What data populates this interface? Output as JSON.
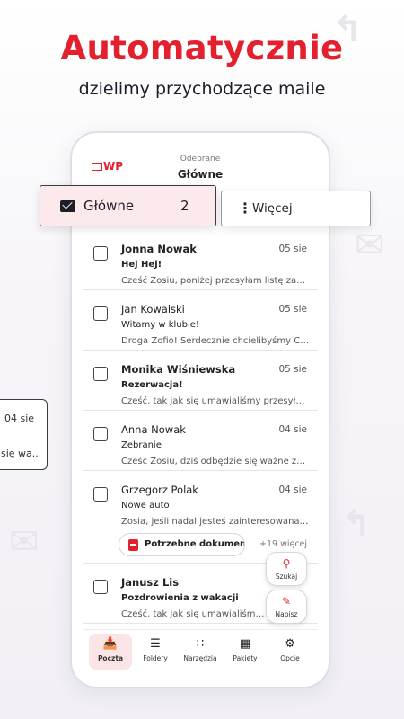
{
  "promo": {
    "headline": "Automatycznie",
    "subheadline": "dzielimy przychodzące maile"
  },
  "app": {
    "logo_text": "WP",
    "header_subtitle": "Odebrane",
    "header_title": "Główne"
  },
  "folder_tabs": {
    "main_label": "Główne",
    "main_count": "2",
    "more_label": "Więcej"
  },
  "mails": [
    {
      "from": "Jonna Nowak",
      "date": "05 sie",
      "subject": "Hej Hej!",
      "preview": "Cześć Zosiu, poniżej przesyłam listę zada...",
      "unread": true
    },
    {
      "from": "Jan Kowalski",
      "date": "05 sie",
      "subject": "Witamy w klubie!",
      "preview": "Droga Zofio! Serdecznie chcielibyśmy Cię...",
      "unread": false
    },
    {
      "from": "Monika Wiśniewska",
      "date": "05 sie",
      "subject": "Rezerwacja!",
      "preview": "Cześć, tak jak się umawialiśmy przesyłama",
      "unread": true
    },
    {
      "from": "Anna Nowak",
      "date": "04 sie",
      "subject": "Zebranie",
      "preview": "Cześć Zosiu, dziś odbędzie się ważne ze...",
      "unread": false
    },
    {
      "from": "Grzegorz Polak",
      "date": "04 sie",
      "subject": "Nowe auto",
      "preview": "Zosia, jeśli nadal jesteś zainteresowana k...",
      "unread": false,
      "attachment": "Potrzebne dokumen...",
      "more": "+19 więcej"
    },
    {
      "from": "Janusz Lis",
      "date": "",
      "subject": "Pozdrowienia z wakacji",
      "preview": "Cześć, tak jak się umawialiśmy przes...",
      "unread": true
    }
  ],
  "fabs": {
    "search_label": "Szukaj",
    "compose_label": "Napisz"
  },
  "bottom_nav": [
    {
      "label": "Poczta",
      "icon": "inbox-icon",
      "active": true
    },
    {
      "label": "Foldery",
      "icon": "menu-icon",
      "active": false
    },
    {
      "label": "Narzędzia",
      "icon": "grid-icon",
      "active": false
    },
    {
      "label": "Pakiety",
      "icon": "package-icon",
      "active": false
    },
    {
      "label": "Opcje",
      "icon": "gear-icon",
      "active": false
    }
  ],
  "peek_card": {
    "date": "04 sie",
    "preview": "się wa..."
  },
  "colors": {
    "brand": "#e3212e",
    "active_tab_bg": "#fbe9eb"
  }
}
